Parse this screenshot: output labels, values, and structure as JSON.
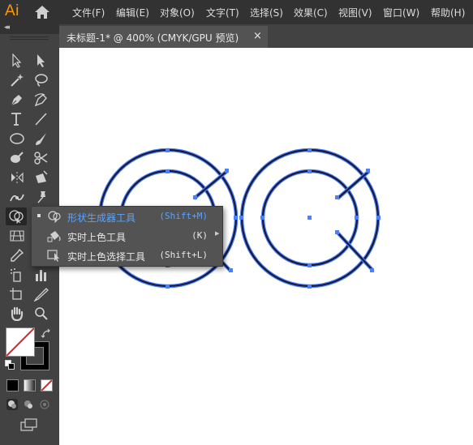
{
  "app": {
    "logo": "Ai"
  },
  "menu": [
    "文件(F)",
    "编辑(E)",
    "对象(O)",
    "文字(T)",
    "选择(S)",
    "效果(C)",
    "视图(V)",
    "窗口(W)",
    "帮助(H)"
  ],
  "document_tab": {
    "title": "未标题-1* @ 400% (CMYK/GPU 预览)",
    "close": "×"
  },
  "toolbar": {
    "collapse": "◂◂"
  },
  "flyout": {
    "items": [
      {
        "label": "形状生成器工具",
        "shortcut": "(Shift+M)",
        "selected": true,
        "icon": "shape-builder-icon"
      },
      {
        "label": "实时上色工具",
        "shortcut": "(K)",
        "selected": false,
        "icon": "live-paint-bucket-icon"
      },
      {
        "label": "实时上色选择工具",
        "shortcut": "(Shift+L)",
        "selected": false,
        "icon": "live-paint-selection-icon"
      }
    ]
  },
  "colors": {
    "accent": "#59a3ff",
    "path_stroke": "#1a1a3a",
    "anchor": "#4a7fff",
    "logo": "#ff9a00"
  }
}
